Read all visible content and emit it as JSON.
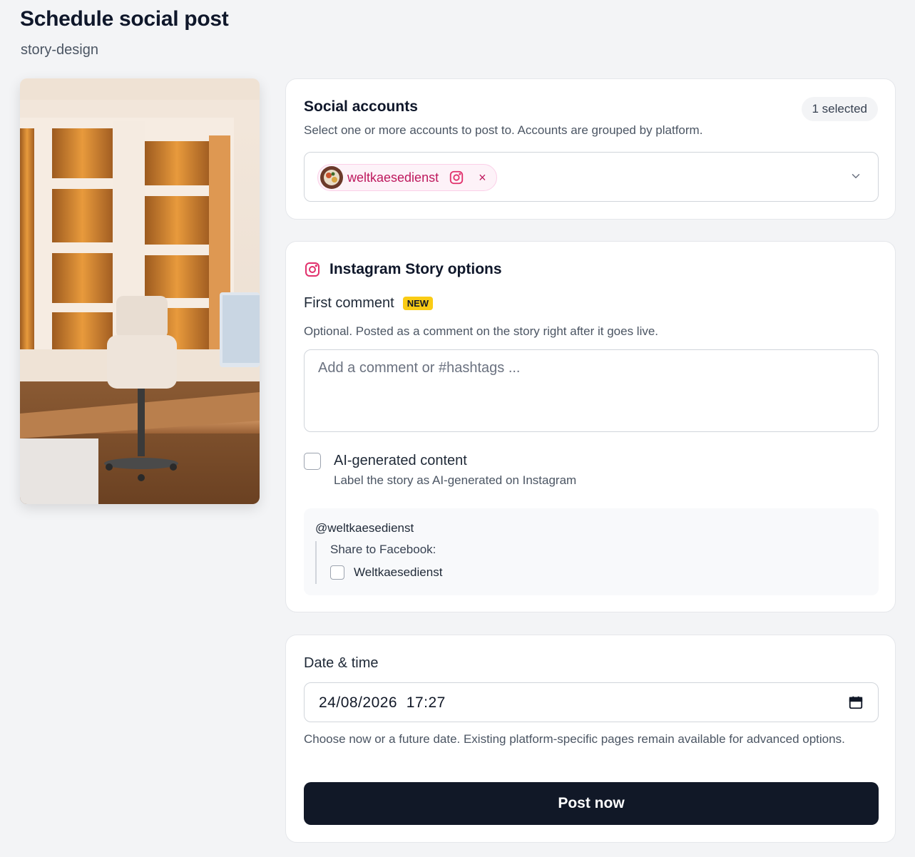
{
  "page": {
    "title": "Schedule social post",
    "subtitle": "story-design"
  },
  "preview": {
    "image": "office-interior-photo"
  },
  "accounts": {
    "heading": "Social accounts",
    "description": "Select one or more accounts to post to. Accounts are grouped by platform.",
    "selected_count": "1 selected",
    "chips": [
      {
        "label": "weltkaesedienst",
        "platform_icon": "instagram-icon",
        "remove_symbol": "×"
      }
    ],
    "dropdown_icon": "chevron-down-icon"
  },
  "instagram": {
    "heading": "Instagram Story options",
    "icon": "instagram-icon",
    "first_comment_label": "First comment",
    "new_badge": "NEW",
    "first_comment_help": "Optional. Posted as a comment on the story right after it goes live.",
    "comment_placeholder": "Add a comment or #hashtags ...",
    "comment_value": "",
    "ai_label": "AI-generated content",
    "ai_help": "Label the story as AI-generated on Instagram",
    "ai_checked": false,
    "fb_handle": "@weltkaesedienst",
    "fb_share_label": "Share to Facebook:",
    "fb_page": "Weltkaesedienst",
    "fb_checked": false
  },
  "schedule": {
    "label": "Date & time",
    "value": "24/08/2026  17:27",
    "help": "Choose now or a future date. Existing platform-specific pages remain available for advanced options.",
    "calendar_icon": "calendar-icon",
    "post_button": "Post now"
  },
  "colors": {
    "background": "#f3f4f6",
    "chip_text": "#be185d",
    "instagram_pink": "#e1306c",
    "new_badge": "#facc15",
    "primary_button": "#111827"
  }
}
